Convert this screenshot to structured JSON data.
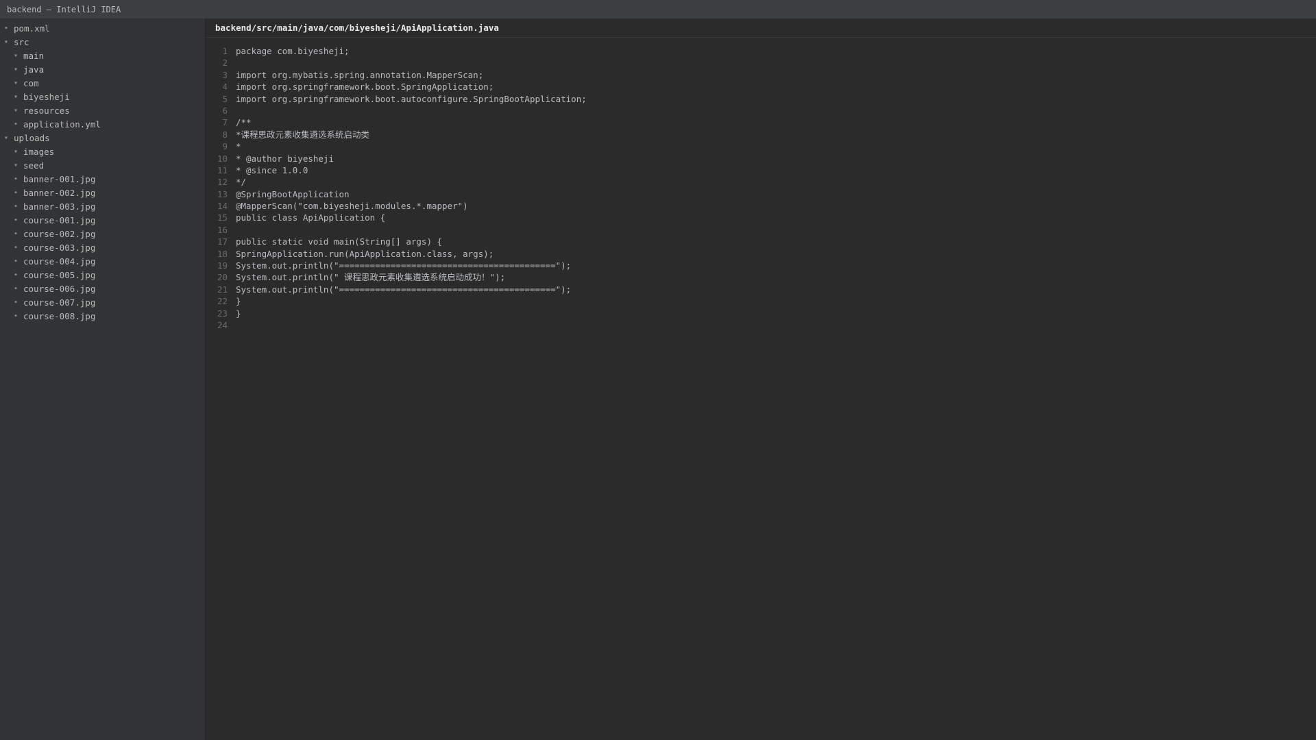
{
  "window": {
    "title": "backend — IntelliJ IDEA"
  },
  "sidebar": {
    "items": [
      {
        "label": "pom.xml",
        "marker": "•"
      },
      {
        "label": "src",
        "marker": "▾"
      },
      {
        "label": "main",
        "marker": "▾"
      },
      {
        "label": "java",
        "marker": "▾"
      },
      {
        "label": "com",
        "marker": "▾"
      },
      {
        "label": "biyesheji",
        "marker": "▾"
      },
      {
        "label": "resources",
        "marker": "▾"
      },
      {
        "label": "application.yml",
        "marker": "•"
      },
      {
        "label": "uploads",
        "marker": "▾"
      },
      {
        "label": "images",
        "marker": "▾"
      },
      {
        "label": "seed",
        "marker": "▾"
      },
      {
        "label": "banner-001.jpg",
        "marker": "•"
      },
      {
        "label": "banner-002.jpg",
        "marker": "•"
      },
      {
        "label": "banner-003.jpg",
        "marker": "•"
      },
      {
        "label": "course-001.jpg",
        "marker": "•"
      },
      {
        "label": "course-002.jpg",
        "marker": "•"
      },
      {
        "label": "course-003.jpg",
        "marker": "•"
      },
      {
        "label": "course-004.jpg",
        "marker": "•"
      },
      {
        "label": "course-005.jpg",
        "marker": "•"
      },
      {
        "label": "course-006.jpg",
        "marker": "•"
      },
      {
        "label": "course-007.jpg",
        "marker": "•"
      },
      {
        "label": "course-008.jpg",
        "marker": "•"
      }
    ]
  },
  "editor": {
    "file_path": "backend/src/main/java/com/biyesheji/ApiApplication.java",
    "lines": [
      {
        "num": "1",
        "text": "package com.biyesheji;"
      },
      {
        "num": "2",
        "text": ""
      },
      {
        "num": "3",
        "text": "import org.mybatis.spring.annotation.MapperScan;"
      },
      {
        "num": "4",
        "text": "import org.springframework.boot.SpringApplication;"
      },
      {
        "num": "5",
        "text": "import org.springframework.boot.autoconfigure.SpringBootApplication;"
      },
      {
        "num": "6",
        "text": ""
      },
      {
        "num": "7",
        "text": "/**"
      },
      {
        "num": "8",
        "text": "*课程思政元素收集遴选系统启动类"
      },
      {
        "num": "9",
        "text": "*"
      },
      {
        "num": "10",
        "text": "* @author biyesheji"
      },
      {
        "num": "11",
        "text": "* @since 1.0.0"
      },
      {
        "num": "12",
        "text": "*/"
      },
      {
        "num": "13",
        "text": "@SpringBootApplication"
      },
      {
        "num": "14",
        "text": "@MapperScan(\"com.biyesheji.modules.*.mapper\")"
      },
      {
        "num": "15",
        "text": "public class ApiApplication {"
      },
      {
        "num": "16",
        "text": ""
      },
      {
        "num": "17",
        "text": "public static void main(String[] args) {"
      },
      {
        "num": "18",
        "text": "SpringApplication.run(ApiApplication.class, args);"
      },
      {
        "num": "19",
        "text": "System.out.println(\"==========================================\");"
      },
      {
        "num": "20",
        "text": "System.out.println(\" 课程思政元素收集遴选系统启动成功！\");"
      },
      {
        "num": "21",
        "text": "System.out.println(\"==========================================\");"
      },
      {
        "num": "22",
        "text": "}"
      },
      {
        "num": "23",
        "text": "}"
      },
      {
        "num": "24",
        "text": ""
      }
    ]
  }
}
